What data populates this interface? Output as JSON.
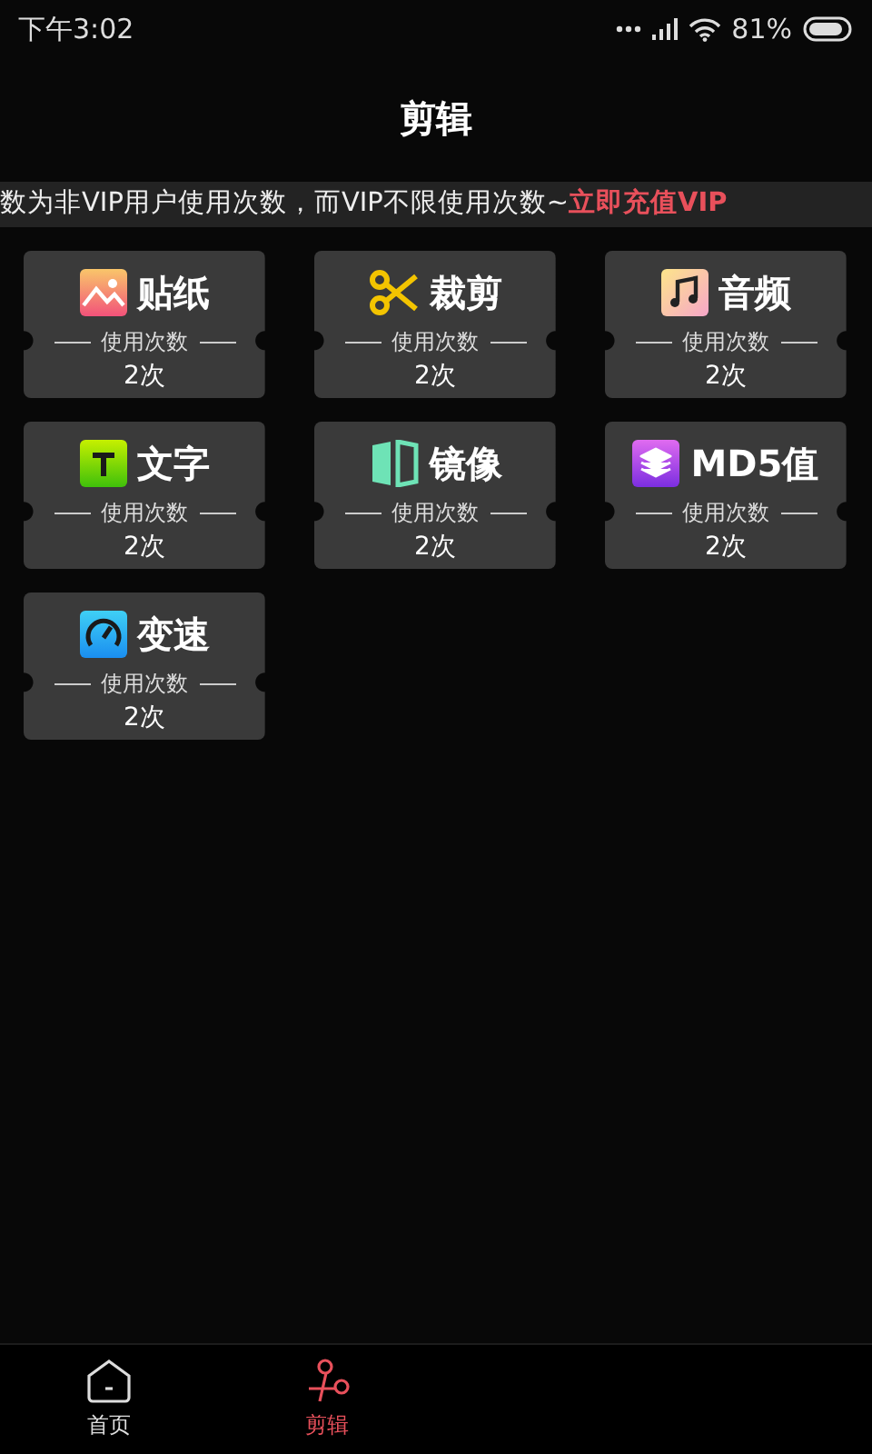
{
  "status_bar": {
    "time": "下午3:02",
    "battery": "81%"
  },
  "header": {
    "title": "剪辑"
  },
  "notice": {
    "text": "数为非VIP用户使用次数，而VIP不限使用次数~",
    "link": "立即充值VIP"
  },
  "tools": [
    {
      "kind": "sticker",
      "label": "贴纸",
      "usage_label": "使用次数",
      "count": "2次"
    },
    {
      "kind": "crop",
      "label": "裁剪",
      "usage_label": "使用次数",
      "count": "2次"
    },
    {
      "kind": "audio",
      "label": "音频",
      "usage_label": "使用次数",
      "count": "2次"
    },
    {
      "kind": "text",
      "label": "文字",
      "usage_label": "使用次数",
      "count": "2次"
    },
    {
      "kind": "mirror",
      "label": "镜像",
      "usage_label": "使用次数",
      "count": "2次"
    },
    {
      "kind": "md5",
      "label": "MD5值",
      "usage_label": "使用次数",
      "count": "2次"
    },
    {
      "kind": "speed",
      "label": "变速",
      "usage_label": "使用次数",
      "count": "2次"
    }
  ],
  "bottom_nav": [
    {
      "kind": "home",
      "label": "首页",
      "selected": false
    },
    {
      "kind": "edit",
      "label": "剪辑",
      "selected": true
    }
  ]
}
